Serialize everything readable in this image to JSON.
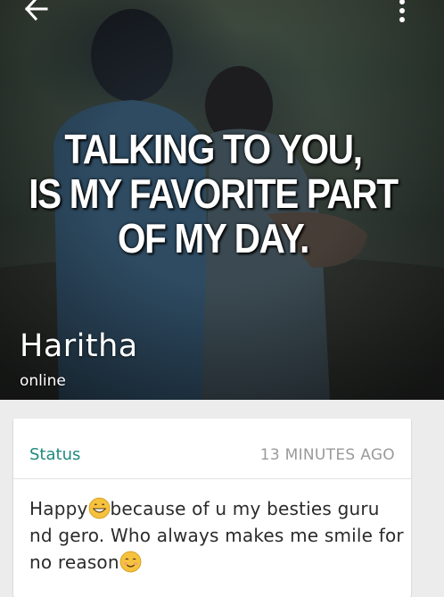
{
  "header": {
    "back_icon": "arrow-left-icon",
    "menu_icon": "more-vertical-icon",
    "profile_photo": {
      "caption_lines": [
        "TALKING TO YOU,",
        "IS  MY FAVORITE PART",
        "OF MY DAY."
      ]
    },
    "contact_name": "Haritha",
    "contact_status": "online"
  },
  "status_card": {
    "title": "Status",
    "time": "13 MINUTES AGO",
    "text_parts": [
      "Happy",
      "because of u my besties guru nd gero. Who always makes me smile for no reason"
    ],
    "emoji_icons": [
      "grinning-face-icon",
      "smiling-face-icon"
    ]
  },
  "colors": {
    "accent": "#1f8a7d",
    "time": "#9a9a9a",
    "emoji": "#f6c23e"
  }
}
